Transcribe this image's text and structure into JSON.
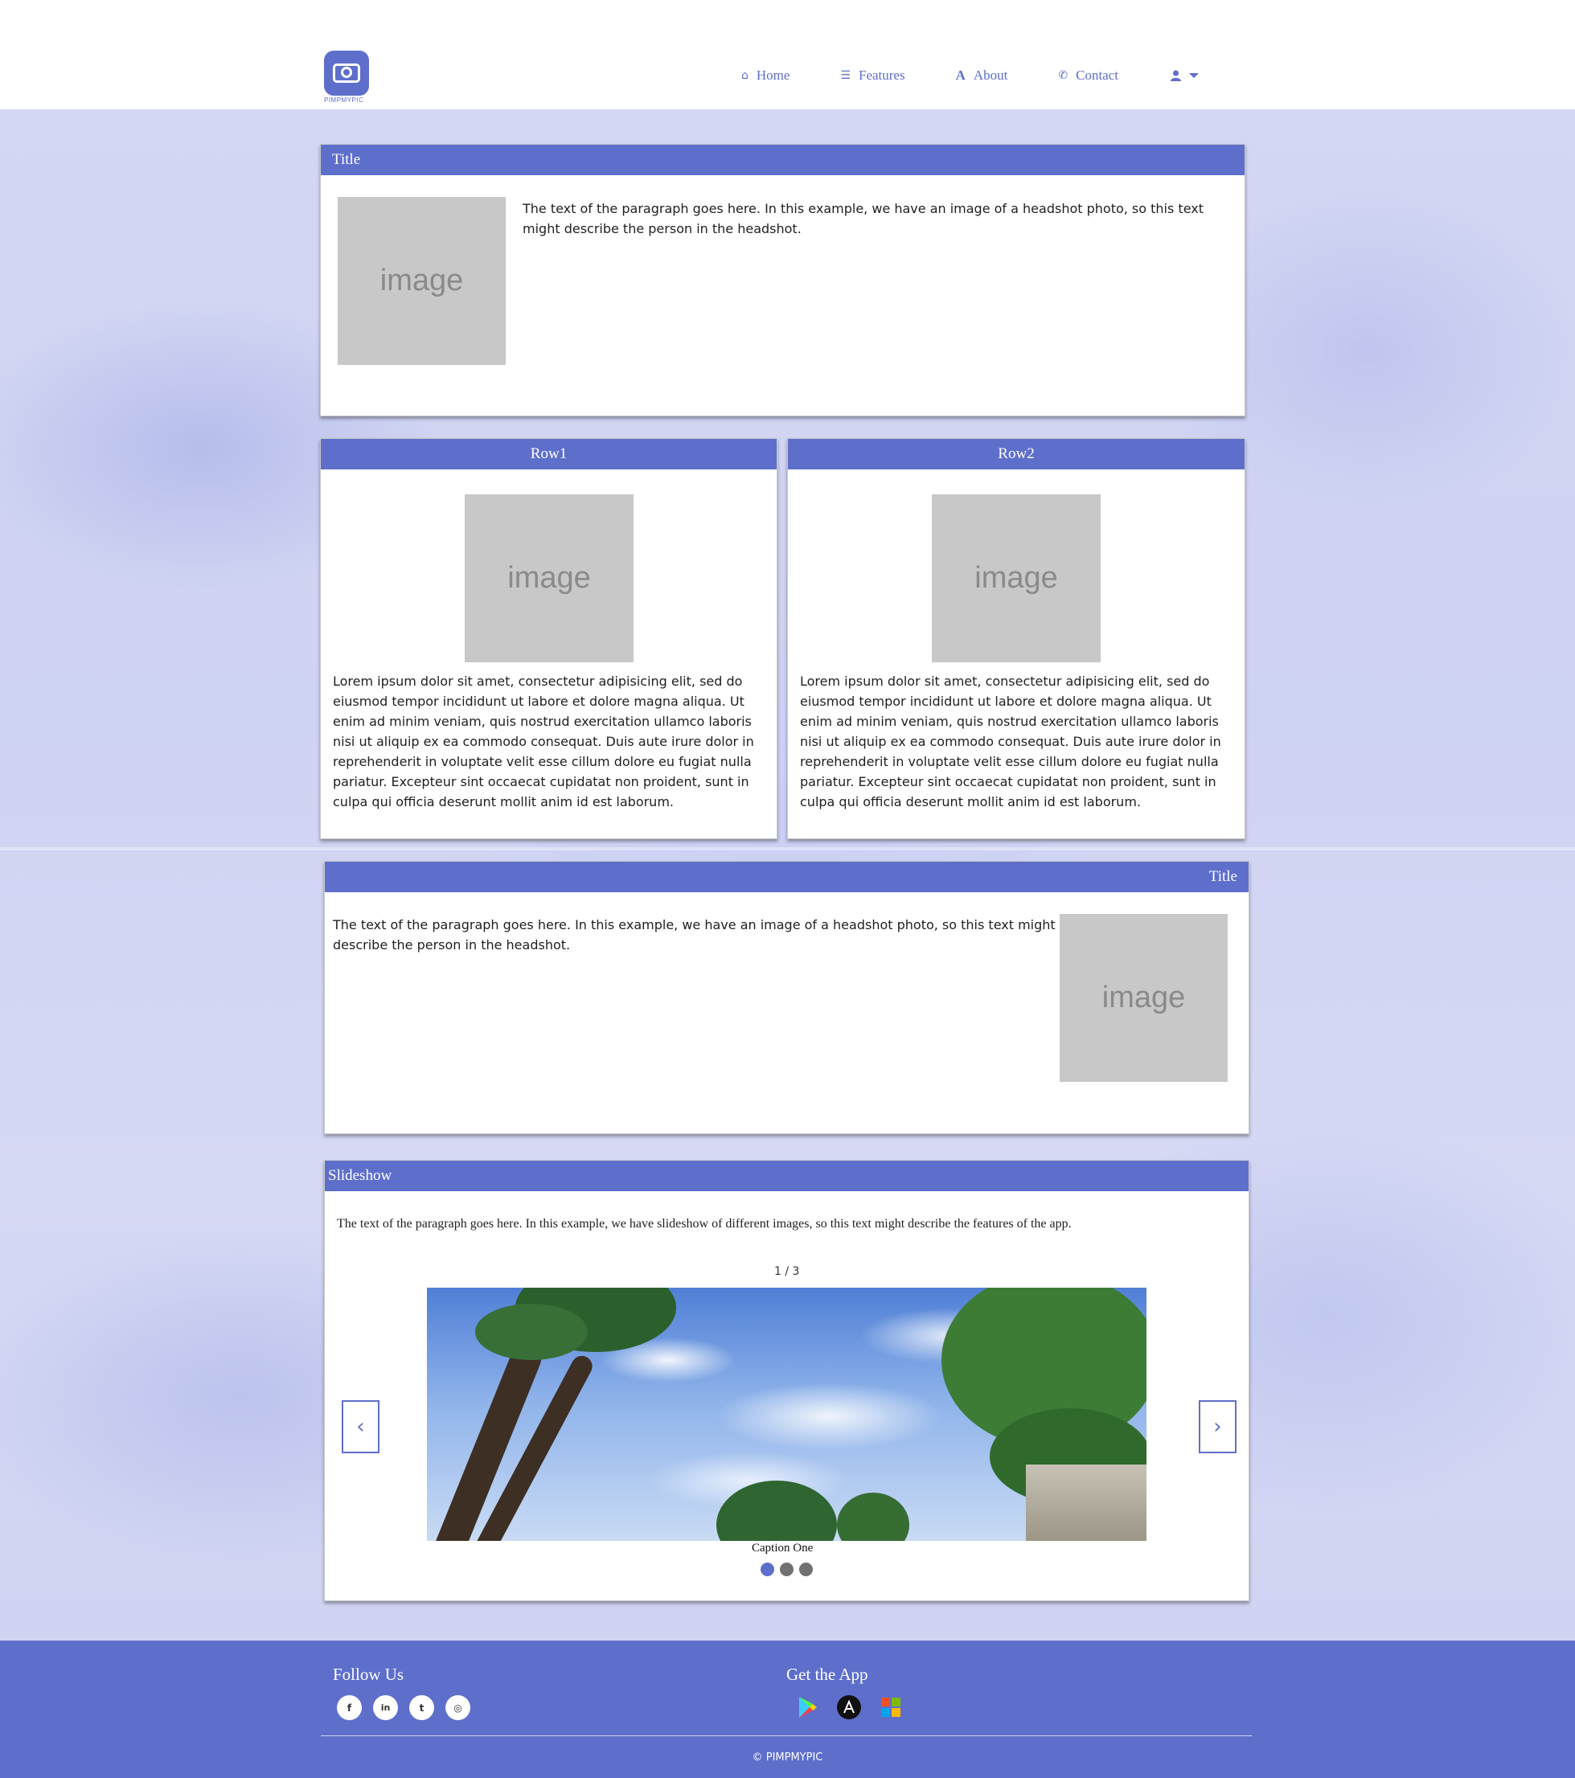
{
  "brand": {
    "logo_text": "PIMPMYPIC",
    "accent": "#5e6fcb"
  },
  "nav": {
    "items": [
      {
        "label": "Home",
        "icon": "home-icon"
      },
      {
        "label": "Features",
        "icon": "list-icon"
      },
      {
        "label": "About",
        "icon": "font-icon"
      },
      {
        "label": "Contact",
        "icon": "phone-icon"
      }
    ],
    "user_menu_icon": "user-icon"
  },
  "card1": {
    "title": "Title",
    "image_label": "image",
    "text": "The text of the paragraph goes here. In this example, we have an image of a headshot photo, so this text might describe the person in the headshot."
  },
  "row1": {
    "title": "Row1",
    "image_label": "image",
    "text": "Lorem ipsum dolor sit amet, consectetur adipisicing elit, sed do eiusmod tempor incididunt ut labore et dolore magna aliqua. Ut enim ad minim veniam, quis nostrud exercitation ullamco laboris nisi ut aliquip ex ea commodo consequat. Duis aute irure dolor in reprehenderit in voluptate velit esse cillum dolore eu fugiat nulla pariatur. Excepteur sint occaecat cupidatat non proident, sunt in culpa qui officia deserunt mollit anim id est laborum."
  },
  "row2": {
    "title": "Row2",
    "image_label": "image",
    "text": "Lorem ipsum dolor sit amet, consectetur adipisicing elit, sed do eiusmod tempor incididunt ut labore et dolore magna aliqua. Ut enim ad minim veniam, quis nostrud exercitation ullamco laboris nisi ut aliquip ex ea commodo consequat. Duis aute irure dolor in reprehenderit in voluptate velit esse cillum dolore eu fugiat nulla pariatur. Excepteur sint occaecat cupidatat non proident, sunt in culpa qui officia deserunt mollit anim id est laborum."
  },
  "card3": {
    "title": "Title",
    "image_label": "image",
    "text": "The text of the paragraph goes here. In this example, we have an image of a headshot photo, so this text might describe the person in the headshot."
  },
  "slideshow": {
    "title": "Slideshow",
    "text": "The text of the paragraph goes here. In this example, we have slideshow of different images, so this text might describe the features of the app.",
    "counter": "1 / 3",
    "caption": "Caption One",
    "prev_label": "‹",
    "next_label": "›",
    "dot_count": 3,
    "active_dot": 1
  },
  "footer": {
    "follow_title": "Follow Us",
    "social": [
      {
        "icon": "facebook-icon",
        "glyph": "f"
      },
      {
        "icon": "linkedin-icon",
        "glyph": "in"
      },
      {
        "icon": "twitter-icon",
        "glyph": "t"
      },
      {
        "icon": "instagram-icon",
        "glyph": "◎"
      }
    ],
    "app_title": "Get the App",
    "apps": [
      "google-play-icon",
      "app-store-icon",
      "microsoft-store-icon"
    ],
    "copyright": "© PIMPMYPIC"
  }
}
